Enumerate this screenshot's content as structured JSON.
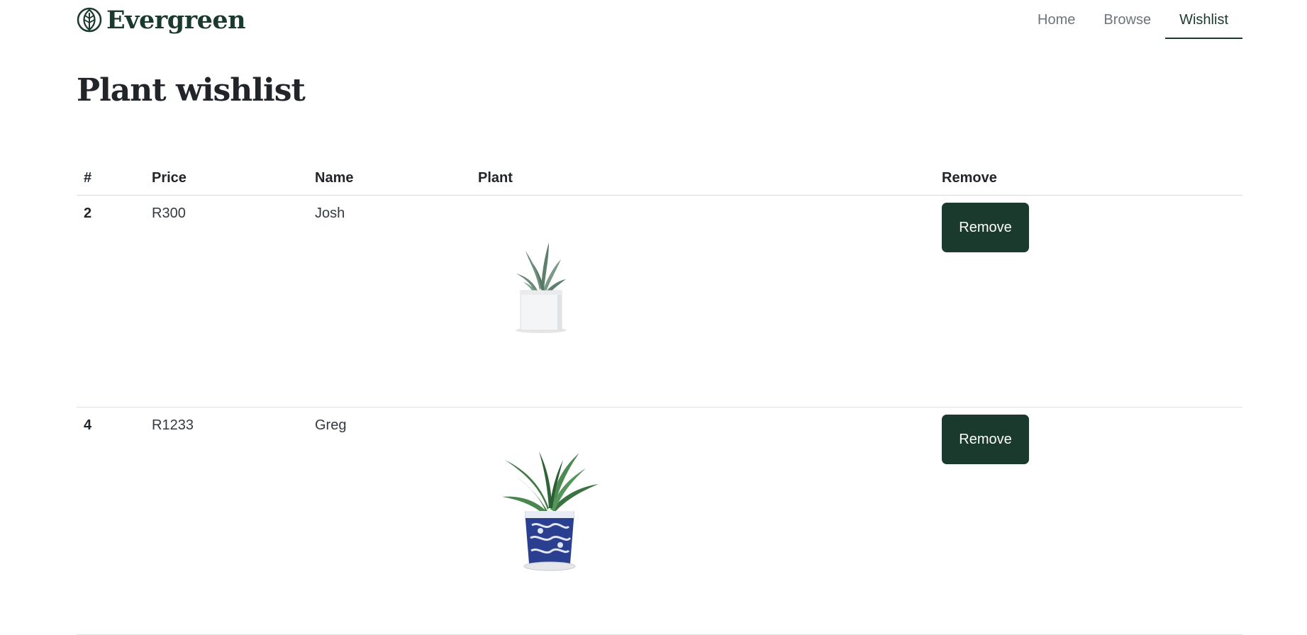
{
  "brand": {
    "name": "Evergreen",
    "icon": "leaf-icon",
    "color": "#1a3a2e"
  },
  "nav": {
    "items": [
      {
        "label": "Home",
        "active": false
      },
      {
        "label": "Browse",
        "active": false
      },
      {
        "label": "Wishlist",
        "active": true
      }
    ]
  },
  "page": {
    "title": "Plant wishlist"
  },
  "table": {
    "headers": [
      "#",
      "Price",
      "Name",
      "Plant",
      "Remove"
    ],
    "rows": [
      {
        "index": "2",
        "price": "R300",
        "name": "Josh",
        "plant_image": "succulent-in-white-pot",
        "action": "Remove"
      },
      {
        "index": "4",
        "price": "R1233",
        "name": "Greg",
        "plant_image": "palm-in-blue-patterned-pot",
        "action": "Remove"
      }
    ]
  },
  "colors": {
    "accent": "#1a3a2e",
    "text": "#212529",
    "muted": "#6c757d",
    "divider": "#dee2e6"
  }
}
